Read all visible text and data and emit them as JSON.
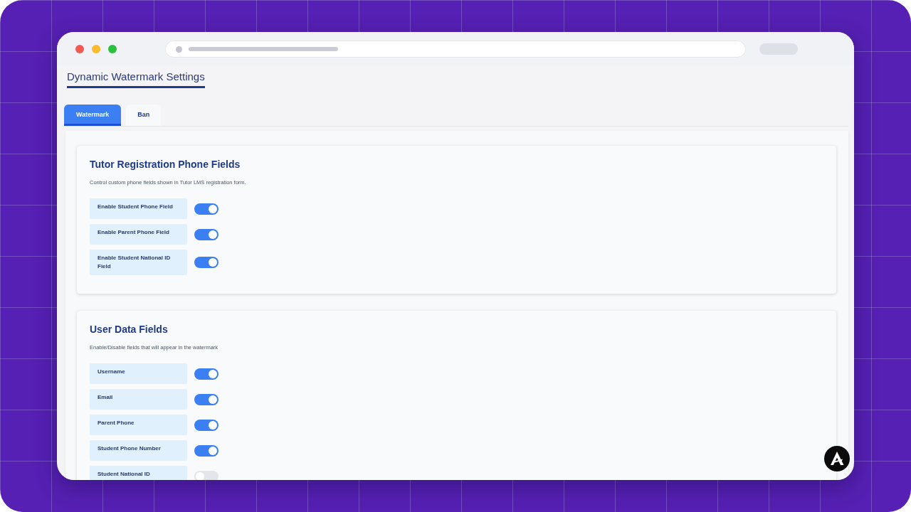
{
  "page": {
    "title": "Dynamic Watermark Settings"
  },
  "tabs": [
    {
      "label": "Watermark",
      "selected": true
    },
    {
      "label": "Ban",
      "selected": false
    }
  ],
  "sections": [
    {
      "title": "Tutor Registration Phone Fields",
      "description": "Control custom phone fields shown in Tutor LMS registration form.",
      "settings": [
        {
          "label": "Enable Student Phone Field",
          "on": true
        },
        {
          "label": "Enable Parent Phone Field",
          "on": true
        },
        {
          "label": "Enable Student National ID Field",
          "on": true
        }
      ]
    },
    {
      "title": "User Data Fields",
      "description": "Enable/Disable fields that will appear in the watermark",
      "settings": [
        {
          "label": "Username",
          "on": true
        },
        {
          "label": "Email",
          "on": true
        },
        {
          "label": "Parent Phone",
          "on": true
        },
        {
          "label": "Student Phone Number",
          "on": true
        },
        {
          "label": "Student National ID",
          "on": false
        }
      ]
    }
  ]
}
